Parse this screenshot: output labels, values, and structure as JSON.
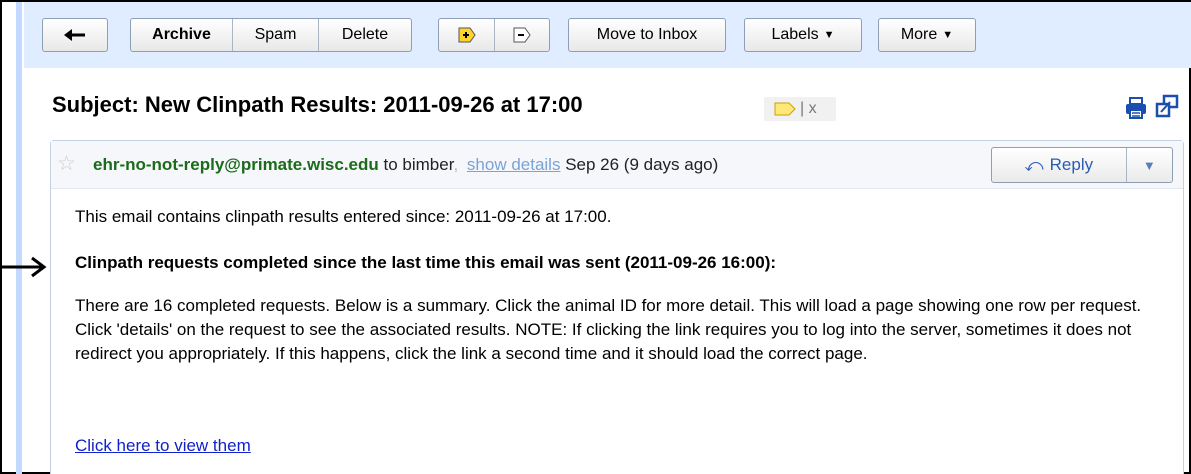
{
  "toolbar": {
    "back_label": "←",
    "archive_label": "Archive",
    "spam_label": "Spam",
    "delete_label": "Delete",
    "mark_important_label": "+",
    "mark_unimportant_label": "−",
    "move_to_inbox_label": "Move to Inbox",
    "labels_label": "Labels",
    "more_label": "More"
  },
  "subject": {
    "text": "Subject: New Clinpath Results: 2011-09-26 at 17:00",
    "label_remove": "| x"
  },
  "message": {
    "sender": "ehr-no-not-reply@primate.wisc.edu",
    "to_text": " to bimber",
    "comma": ",",
    "show_details": "show details",
    "date": "Sep 26 (9 days ago)",
    "reply_label": "Reply",
    "body_line1": "This email contains clinpath results entered since: 2011-09-26 at 17:00.",
    "heading": "Clinpath requests completed since the last time this email was sent (2011-09-26 16:00):",
    "paragraph": "There are 16 completed requests. Below is a summary. Click the animal ID for more detail. This will load a page showing one row per request. Click 'details' on the request to see the associated results. NOTE: If clicking the link requires you to log into the server, sometimes it does not redirect you appropriately. If this happens, click the link a second time and it should load the correct page.",
    "view_link": "Click here to view them"
  },
  "colors": {
    "toolbar_bg": "#e0ecff",
    "rail": "#c3d9ff",
    "sender_green": "#1b6b1b",
    "link_blue": "#1122cc",
    "label_yellow": "#ffe87a"
  },
  "icons": [
    "back-arrow-icon",
    "important-marker-icon",
    "unimportant-marker-icon",
    "caret-down-icon",
    "label-tag-icon",
    "print-icon",
    "new-window-icon",
    "star-icon",
    "reply-arrow-icon",
    "pointer-arrow-icon"
  ]
}
